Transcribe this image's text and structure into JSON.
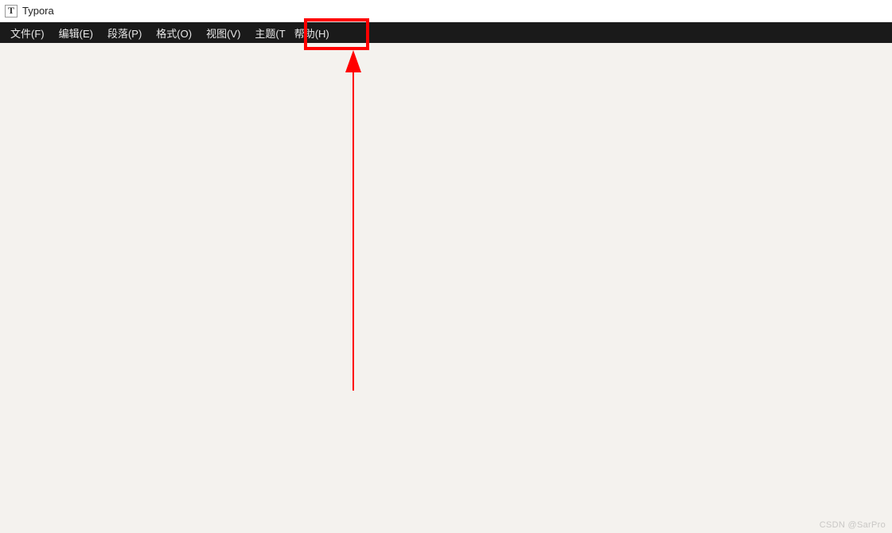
{
  "title_bar": {
    "icon_letter": "T",
    "app_name": "Typora"
  },
  "menu_bar": {
    "items": [
      {
        "label": "文件(F)"
      },
      {
        "label": "编辑(E)"
      },
      {
        "label": "段落(P)"
      },
      {
        "label": "格式(O)"
      },
      {
        "label": "视图(V)"
      },
      {
        "label": "主题(T"
      },
      {
        "label": "帮助(H)"
      }
    ]
  },
  "annotation": {
    "highlight_color": "#ff0000"
  },
  "watermark": {
    "text": "CSDN @SarPro"
  }
}
